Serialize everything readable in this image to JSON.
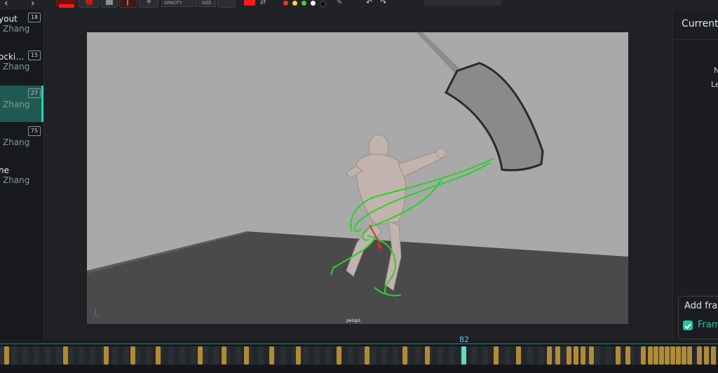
{
  "toolbar": {
    "opacity_label": "OPACITY",
    "size_label": "SIZE",
    "colors": [
      "#ff2e2e",
      "#ffd22e",
      "#3ad13a",
      "#ffffff",
      "#111111"
    ]
  },
  "sidebar": {
    "items": [
      {
        "title": "yout",
        "owner": "Zhang",
        "count": "18"
      },
      {
        "title": "ocki…",
        "owner": "Zhang",
        "count": "15"
      },
      {
        "title": "",
        "owner": "Zhang",
        "count": "27"
      },
      {
        "title": "",
        "owner": "Zhang",
        "count": "75"
      },
      {
        "title": "ne",
        "owner": "Zhang",
        "count": ""
      }
    ]
  },
  "viewport": {
    "camera_label": "persp1"
  },
  "right_panel": {
    "title": "Current",
    "label_n": "N",
    "label_le": "Le"
  },
  "add_frame": {
    "title": "Add fra",
    "checkbox_label": "Fram"
  },
  "timeline": {
    "current_frame": "82"
  }
}
